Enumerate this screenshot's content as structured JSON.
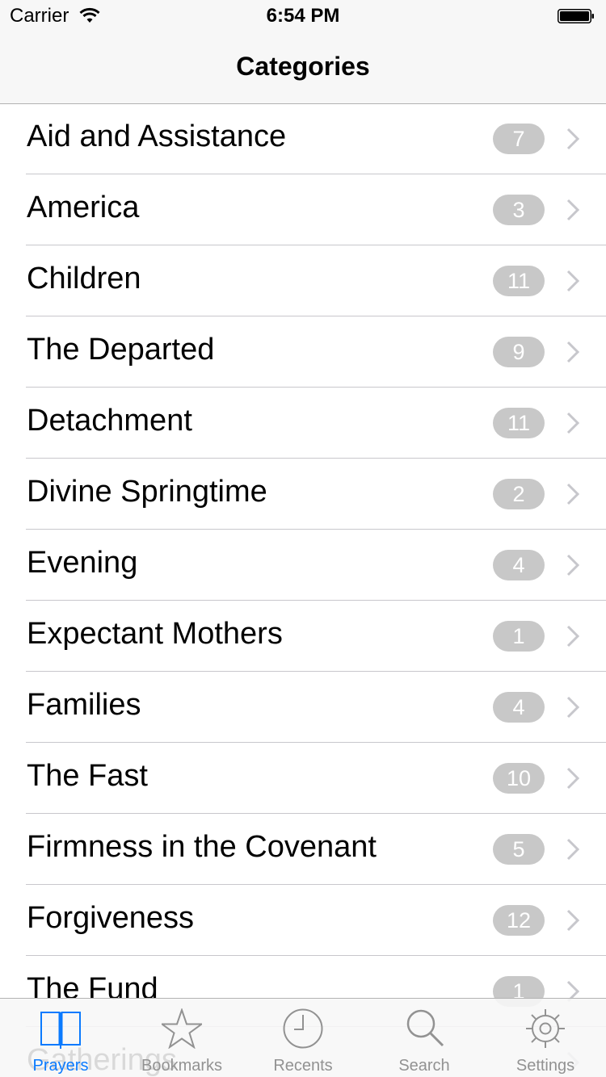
{
  "status_bar": {
    "carrier": "Carrier",
    "time": "6:54 PM"
  },
  "nav": {
    "title": "Categories"
  },
  "categories": [
    {
      "label": "Aid and Assistance",
      "count": "7"
    },
    {
      "label": "America",
      "count": "3"
    },
    {
      "label": "Children",
      "count": "11"
    },
    {
      "label": "The Departed",
      "count": "9"
    },
    {
      "label": "Detachment",
      "count": "11"
    },
    {
      "label": "Divine Springtime",
      "count": "2"
    },
    {
      "label": "Evening",
      "count": "4"
    },
    {
      "label": "Expectant Mothers",
      "count": "1"
    },
    {
      "label": "Families",
      "count": "4"
    },
    {
      "label": "The Fast",
      "count": "10"
    },
    {
      "label": "Firmness in the Covenant",
      "count": "5"
    },
    {
      "label": "Forgiveness",
      "count": "12"
    },
    {
      "label": "The Fund",
      "count": "1"
    },
    {
      "label": "Gatherings",
      "count": ""
    }
  ],
  "tabbar": {
    "tabs": [
      {
        "label": "Prayers",
        "icon": "book-icon",
        "active": true
      },
      {
        "label": "Bookmarks",
        "icon": "star-icon",
        "active": false
      },
      {
        "label": "Recents",
        "icon": "clock-icon",
        "active": false
      },
      {
        "label": "Search",
        "icon": "magnifier-icon",
        "active": false
      },
      {
        "label": "Settings",
        "icon": "gear-icon",
        "active": false
      }
    ]
  },
  "colors": {
    "accent": "#0a7afe",
    "badge": "#c8c8c8",
    "inactive_tab": "#929292"
  }
}
